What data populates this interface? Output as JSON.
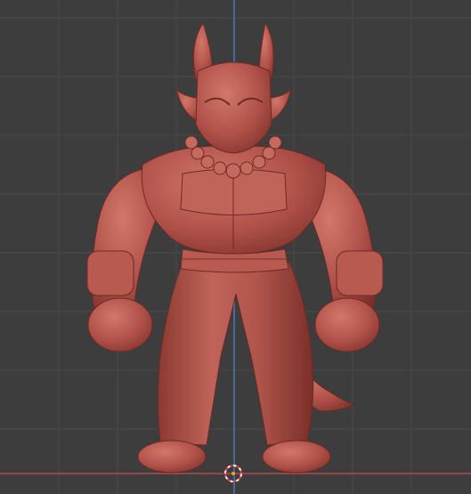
{
  "viewport": {
    "background_color": "#3d3d3d",
    "grid_color": "#4a4a4a",
    "x_axis_color": "#b04a52",
    "y_axis_color": "#4a78b8",
    "model_color": "#b1524a",
    "model_shadow_color": "#6e2a24",
    "model_highlight_color": "#d2776b",
    "cursor_icon": "3d-cursor-icon"
  }
}
